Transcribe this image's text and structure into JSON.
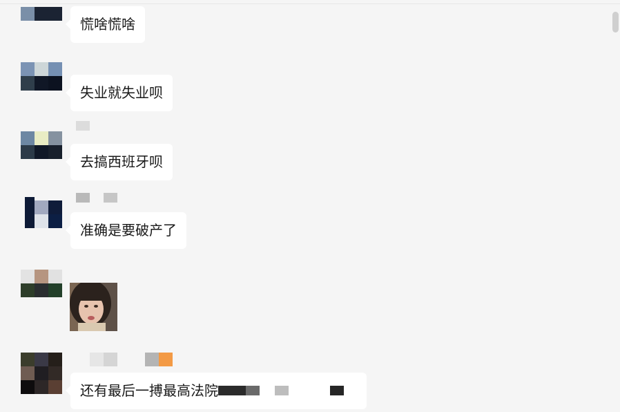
{
  "colors": {
    "background": "#f5f5f5",
    "bubble": "#ffffff",
    "text": "#191919"
  },
  "messages": [
    {
      "text": "慌啥慌啥"
    },
    {
      "text": "失业就失业呗"
    },
    {
      "text": "去搞西班牙呗"
    },
    {
      "text": "准确是要破产了"
    },
    {
      "image": "sticker-photo"
    },
    {
      "text": "还有最后一搏最高法院"
    }
  ]
}
